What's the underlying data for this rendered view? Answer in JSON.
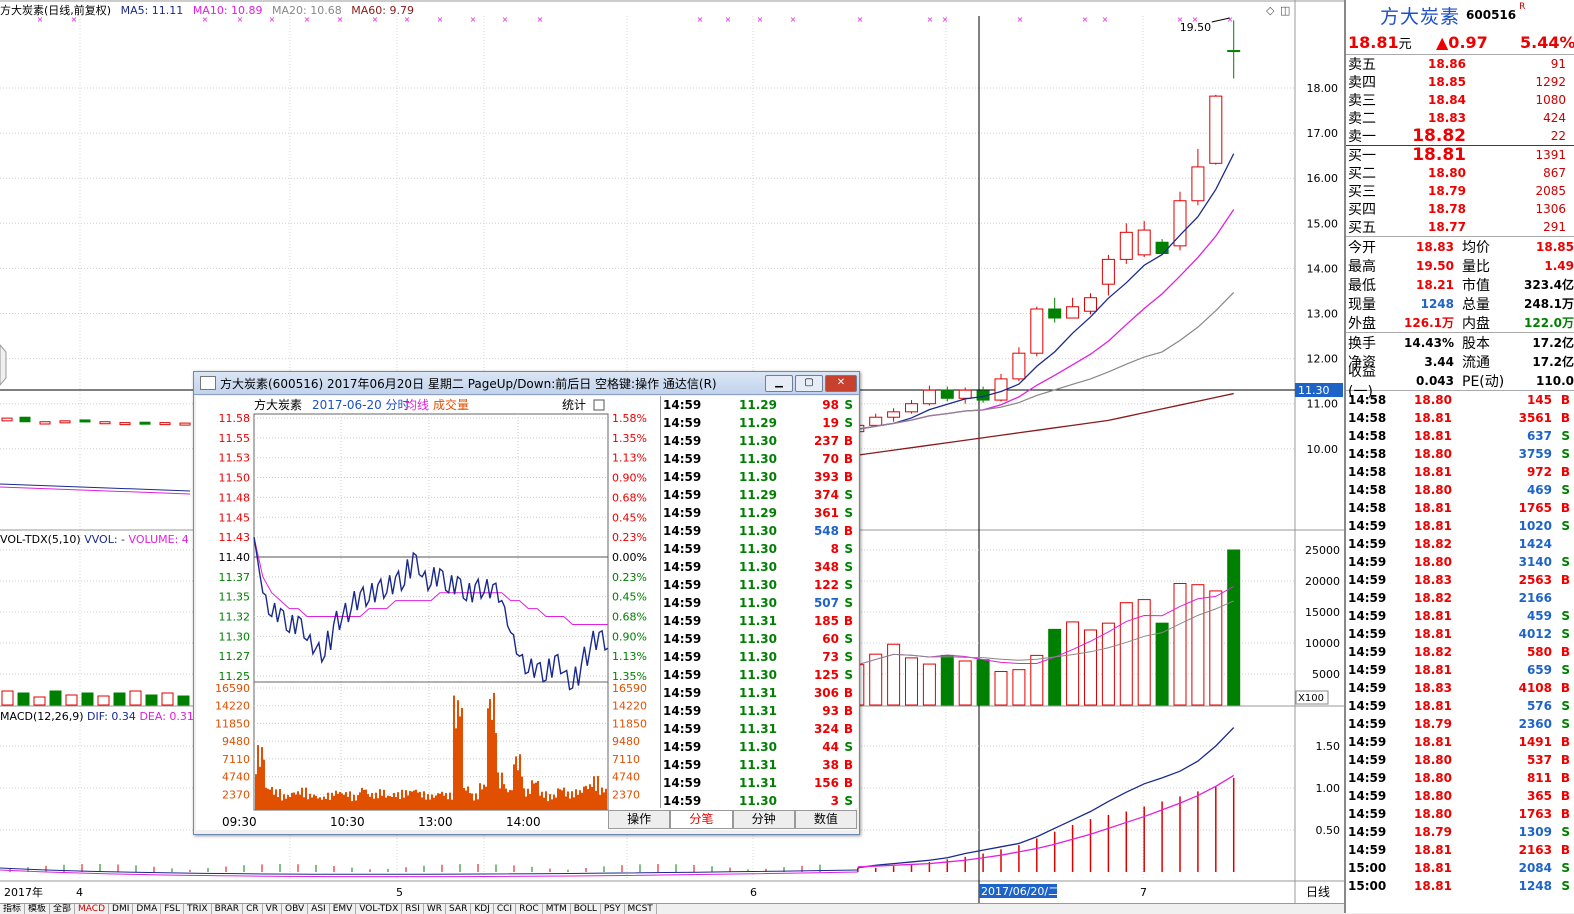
{
  "header": {
    "stock_title": "方大炭素(日线,前复权)",
    "ma5": "MA5: 11.11",
    "ma10": "MA10: 10.89",
    "ma20": "MA20: 10.68",
    "ma60": "MA60: 9.79",
    "high_marker": "19.50"
  },
  "price_axis": [
    "18.00",
    "17.00",
    "16.00",
    "15.00",
    "14.00",
    "13.00",
    "12.00",
    "11.00",
    "10.00"
  ],
  "crosshair_price": "11.30",
  "vol_header": {
    "name": "VOL-TDX(5,10)",
    "vvol": "VVOL: -",
    "volume": "VOLUME: 4"
  },
  "vol_axis": [
    "25000",
    "20000",
    "15000",
    "10000",
    "5000"
  ],
  "vol_unit": "X100",
  "macd_header": {
    "name": "MACD(12,26,9)",
    "dif": "DIF: 0.34",
    "dea": "DEA: 0.31"
  },
  "macd_axis": [
    "1.50",
    "1.00",
    "0.50"
  ],
  "date_axis": {
    "year": "2017年",
    "m4": "4",
    "m5": "5",
    "m6": "6",
    "cursor": "2017/06/20/二",
    "m7": "7",
    "period": "日线"
  },
  "tabs": [
    "指标",
    "模板",
    "全部",
    "MACD",
    "DMI",
    "DMA",
    "FSL",
    "TRIX",
    "BRAR",
    "CR",
    "VR",
    "OBV",
    "ASI",
    "EMV",
    "VOL-TDX",
    "RSI",
    "WR",
    "SAR",
    "KDJ",
    "CCI",
    "ROC",
    "MTM",
    "BOLL",
    "PSY",
    "MCST"
  ],
  "active_tab": "MACD",
  "colors": {
    "up": "#e00000",
    "down": "#008000",
    "ma5": "#1a2a8c",
    "ma10": "#e020e0",
    "ma20": "#888888",
    "ma60": "#8b1a1a"
  },
  "chart_data": {
    "type": "candlestick",
    "candles": [
      [
        10.55,
        10.4,
        10.62,
        10.32
      ],
      [
        10.42,
        10.38,
        10.5,
        10.3
      ],
      [
        10.38,
        10.52,
        10.6,
        10.33
      ],
      [
        10.52,
        10.7,
        10.78,
        10.48
      ],
      [
        10.7,
        10.82,
        10.9,
        10.6
      ],
      [
        10.82,
        11.0,
        11.08,
        10.78
      ],
      [
        11.0,
        11.3,
        11.4,
        10.96
      ],
      [
        11.3,
        11.12,
        11.38,
        11.05
      ],
      [
        11.12,
        11.3,
        11.36,
        11.0
      ],
      [
        11.28,
        11.08,
        11.38,
        11.02
      ],
      [
        11.08,
        11.55,
        11.66,
        11.05
      ],
      [
        11.55,
        12.12,
        12.25,
        11.5
      ],
      [
        12.12,
        13.1,
        13.15,
        12.05
      ],
      [
        13.1,
        12.9,
        13.35,
        12.8
      ],
      [
        12.9,
        13.15,
        13.35,
        12.9
      ],
      [
        13.05,
        13.35,
        13.45,
        12.98
      ],
      [
        13.65,
        14.2,
        14.3,
        13.4
      ],
      [
        14.2,
        14.8,
        15.0,
        14.1
      ],
      [
        14.3,
        14.85,
        15.05,
        14.25
      ],
      [
        14.58,
        14.33,
        14.65,
        14.3
      ],
      [
        14.5,
        15.5,
        15.7,
        14.4
      ],
      [
        15.5,
        16.25,
        16.65,
        15.4
      ],
      [
        16.33,
        17.82,
        17.85,
        16.3
      ],
      [
        18.83,
        18.81,
        19.5,
        18.21
      ]
    ],
    "volumes": [
      6500,
      8200,
      9800,
      7600,
      6600,
      8000,
      7100,
      7300,
      5400,
      5700,
      8000,
      12200,
      13400,
      12100,
      13200,
      16500,
      17000,
      13200,
      19600,
      19400,
      18400,
      25000
    ],
    "dif": [
      0.05,
      0.08,
      0.1,
      0.12,
      0.14,
      0.17,
      0.22,
      0.26,
      0.3,
      0.34,
      0.42,
      0.52,
      0.62,
      0.72,
      0.84,
      0.95,
      1.05,
      1.12,
      1.2,
      1.32,
      1.5,
      1.72
    ],
    "dea": [
      0.06,
      0.07,
      0.08,
      0.09,
      0.1,
      0.12,
      0.14,
      0.17,
      0.2,
      0.24,
      0.28,
      0.33,
      0.39,
      0.45,
      0.52,
      0.59,
      0.66,
      0.74,
      0.82,
      0.91,
      1.02,
      1.15
    ],
    "macd_bar": [
      0.05,
      0.05,
      0.07,
      0.09,
      0.12,
      0.15,
      0.18,
      0.22,
      0.27,
      0.32,
      0.4,
      0.48,
      0.56,
      0.63,
      0.68,
      0.72,
      0.78,
      0.84,
      0.9,
      0.96,
      1.02,
      1.12
    ],
    "ylim": [
      9.6,
      19.8
    ]
  },
  "panel": {
    "name": "方大炭素",
    "code": "600516",
    "r_mark": "R",
    "price": "18.81",
    "unit": "元",
    "change": "▲0.97",
    "pct": "5.44%",
    "asks": [
      {
        "label": "卖五",
        "price": "18.86",
        "vol": "91"
      },
      {
        "label": "卖四",
        "price": "18.85",
        "vol": "1292"
      },
      {
        "label": "卖三",
        "price": "18.84",
        "vol": "1080"
      },
      {
        "label": "卖二",
        "price": "18.83",
        "vol": "424"
      },
      {
        "label": "卖一",
        "price": "18.82",
        "vol": "22"
      }
    ],
    "bids": [
      {
        "label": "买一",
        "price": "18.81",
        "vol": "1391"
      },
      {
        "label": "买二",
        "price": "18.80",
        "vol": "867"
      },
      {
        "label": "买三",
        "price": "18.79",
        "vol": "2085"
      },
      {
        "label": "买四",
        "price": "18.78",
        "vol": "1306"
      },
      {
        "label": "买五",
        "price": "18.77",
        "vol": "291"
      }
    ],
    "stats1": [
      {
        "l": "今开",
        "v": "18.83",
        "vc": "red",
        "l2": "均价",
        "v2": "18.85",
        "v2c": "red"
      },
      {
        "l": "最高",
        "v": "19.50",
        "vc": "red",
        "l2": "量比",
        "v2": "1.49",
        "v2c": "red"
      },
      {
        "l": "最低",
        "v": "18.21",
        "vc": "red",
        "l2": "市值",
        "v2": "323.4亿",
        "v2c": "blk"
      },
      {
        "l": "现量",
        "v": "1248",
        "vc": "blue",
        "l2": "总量",
        "v2": "248.1万",
        "v2c": "blk"
      },
      {
        "l": "外盘",
        "v": "126.1万",
        "vc": "red",
        "l2": "内盘",
        "v2": "122.0万",
        "v2c": "green"
      }
    ],
    "stats2": [
      {
        "l": "换手",
        "v": "14.43%",
        "vc": "blk",
        "l2": "股本",
        "v2": "17.2亿",
        "v2c": "blk"
      },
      {
        "l": "净资",
        "v": "3.44",
        "vc": "blk",
        "l2": "流通",
        "v2": "17.2亿",
        "v2c": "blk"
      },
      {
        "l": "收益(一)",
        "v": "0.043",
        "vc": "blk",
        "l2": "PE(动)",
        "v2": "110.0",
        "v2c": "blk"
      }
    ],
    "ticks": [
      [
        "14:58",
        "18.80",
        "145",
        "B"
      ],
      [
        "14:58",
        "18.81",
        "3561",
        "B"
      ],
      [
        "14:58",
        "18.81",
        "637",
        "S"
      ],
      [
        "14:58",
        "18.80",
        "3759",
        "S"
      ],
      [
        "14:58",
        "18.81",
        "972",
        "B"
      ],
      [
        "14:58",
        "18.80",
        "469",
        "S"
      ],
      [
        "14:58",
        "18.81",
        "1765",
        "B"
      ],
      [
        "14:59",
        "18.81",
        "1020",
        "S"
      ],
      [
        "14:59",
        "18.82",
        "1424",
        ""
      ],
      [
        "14:59",
        "18.80",
        "3140",
        "S"
      ],
      [
        "14:59",
        "18.83",
        "2563",
        "B"
      ],
      [
        "14:59",
        "18.82",
        "2166",
        ""
      ],
      [
        "14:59",
        "18.81",
        "459",
        "S"
      ],
      [
        "14:59",
        "18.81",
        "4012",
        "S"
      ],
      [
        "14:59",
        "18.82",
        "580",
        "B"
      ],
      [
        "14:59",
        "18.81",
        "659",
        "S"
      ],
      [
        "14:59",
        "18.83",
        "4108",
        "B"
      ],
      [
        "14:59",
        "18.81",
        "576",
        "S"
      ],
      [
        "14:59",
        "18.79",
        "2360",
        "S"
      ],
      [
        "14:59",
        "18.81",
        "1491",
        "B"
      ],
      [
        "14:59",
        "18.80",
        "537",
        "B"
      ],
      [
        "14:59",
        "18.80",
        "811",
        "B"
      ],
      [
        "14:59",
        "18.80",
        "365",
        "B"
      ],
      [
        "14:59",
        "18.80",
        "1763",
        "B"
      ],
      [
        "14:59",
        "18.79",
        "1309",
        "S"
      ],
      [
        "14:59",
        "18.81",
        "2163",
        "B"
      ],
      [
        "15:00",
        "18.81",
        "2084",
        "S"
      ],
      [
        "15:00",
        "18.81",
        "1248",
        "S"
      ]
    ]
  },
  "popup": {
    "title": "方大炭素(600516) 2017年06月20日 星期二 PageUp/Down:前后日 空格键:操作 通达信(R)",
    "inner_name": "方大炭素",
    "inner_date": "2017-06-20 分时",
    "inner_avg": "均线",
    "inner_vol": "成交量",
    "inner_stat": "统计",
    "price_labels": [
      "11.58",
      "11.55",
      "11.53",
      "11.50",
      "11.48",
      "11.45",
      "11.43",
      "11.40",
      "11.37",
      "11.35",
      "11.32",
      "11.30",
      "11.27",
      "11.25"
    ],
    "pct_labels": [
      "1.58%",
      "1.35%",
      "1.13%",
      "0.90%",
      "0.68%",
      "0.45%",
      "0.23%",
      "0.00%",
      "0.23%",
      "0.45%",
      "0.68%",
      "0.90%",
      "1.13%",
      "1.35%"
    ],
    "vol_labels": [
      "16590",
      "14220",
      "11850",
      "9480",
      "7110",
      "4740",
      "2370"
    ],
    "time_labels": [
      "09:30",
      "10:30",
      "13:00",
      "14:00"
    ],
    "tabs": [
      "操作",
      "分笔",
      "分钟",
      "数值"
    ],
    "active_tab": "分笔",
    "ticks": [
      [
        "14:59",
        "11.29",
        "98",
        "S"
      ],
      [
        "14:59",
        "11.29",
        "19",
        "S"
      ],
      [
        "14:59",
        "11.30",
        "237",
        "B"
      ],
      [
        "14:59",
        "11.30",
        "70",
        "B"
      ],
      [
        "14:59",
        "11.30",
        "393",
        "B"
      ],
      [
        "14:59",
        "11.29",
        "374",
        "S"
      ],
      [
        "14:59",
        "11.29",
        "361",
        "S"
      ],
      [
        "14:59",
        "11.30",
        "548",
        "B"
      ],
      [
        "14:59",
        "11.30",
        "8",
        "S"
      ],
      [
        "14:59",
        "11.30",
        "348",
        "S"
      ],
      [
        "14:59",
        "11.30",
        "122",
        "S"
      ],
      [
        "14:59",
        "11.30",
        "507",
        "S"
      ],
      [
        "14:59",
        "11.31",
        "185",
        "B"
      ],
      [
        "14:59",
        "11.30",
        "60",
        "S"
      ],
      [
        "14:59",
        "11.30",
        "73",
        "S"
      ],
      [
        "14:59",
        "11.30",
        "125",
        "S"
      ],
      [
        "14:59",
        "11.31",
        "306",
        "B"
      ],
      [
        "14:59",
        "11.31",
        "93",
        "B"
      ],
      [
        "14:59",
        "11.31",
        "324",
        "B"
      ],
      [
        "14:59",
        "11.30",
        "44",
        "S"
      ],
      [
        "14:59",
        "11.31",
        "38",
        "B"
      ],
      [
        "14:59",
        "11.31",
        "156",
        "B"
      ],
      [
        "14:59",
        "11.30",
        "3",
        "S"
      ]
    ],
    "intraday": {
      "prices": [
        11.43,
        11.36,
        11.33,
        11.34,
        11.31,
        11.33,
        11.3,
        11.29,
        11.28,
        11.32,
        11.33,
        11.34,
        11.36,
        11.35,
        11.37,
        11.36,
        11.38,
        11.37,
        11.41,
        11.38,
        11.37,
        11.39,
        11.36,
        11.38,
        11.35,
        11.37,
        11.36,
        11.37,
        11.35,
        11.31,
        11.28,
        11.26,
        11.27,
        11.25,
        11.28,
        11.26,
        11.24,
        11.27,
        11.29,
        11.31,
        11.29
      ],
      "avg": [
        11.43,
        11.38,
        11.36,
        11.35,
        11.34,
        11.34,
        11.33,
        11.33,
        11.33,
        11.33,
        11.33,
        11.33,
        11.33,
        11.34,
        11.34,
        11.34,
        11.35,
        11.35,
        11.35,
        11.35,
        11.35,
        11.36,
        11.36,
        11.36,
        11.36,
        11.36,
        11.36,
        11.36,
        11.36,
        11.35,
        11.35,
        11.34,
        11.34,
        11.33,
        11.33,
        11.33,
        11.32,
        11.32,
        11.32,
        11.32,
        11.32
      ],
      "vol": [
        9000,
        3400,
        2900,
        2200,
        2700,
        3100,
        2300,
        1900,
        2400,
        2800,
        2600,
        2100,
        3300,
        2400,
        2900,
        2200,
        2500,
        2800,
        3100,
        2600,
        2200,
        2700,
        2400,
        16000,
        3400,
        2300,
        3800,
        16600,
        5200,
        3100,
        7800,
        3000,
        4400,
        2600,
        2200,
        3300,
        2600,
        2900,
        3700,
        4700,
        3200
      ],
      "ylim": [
        11.24,
        11.59
      ],
      "vmax": 16590
    }
  }
}
